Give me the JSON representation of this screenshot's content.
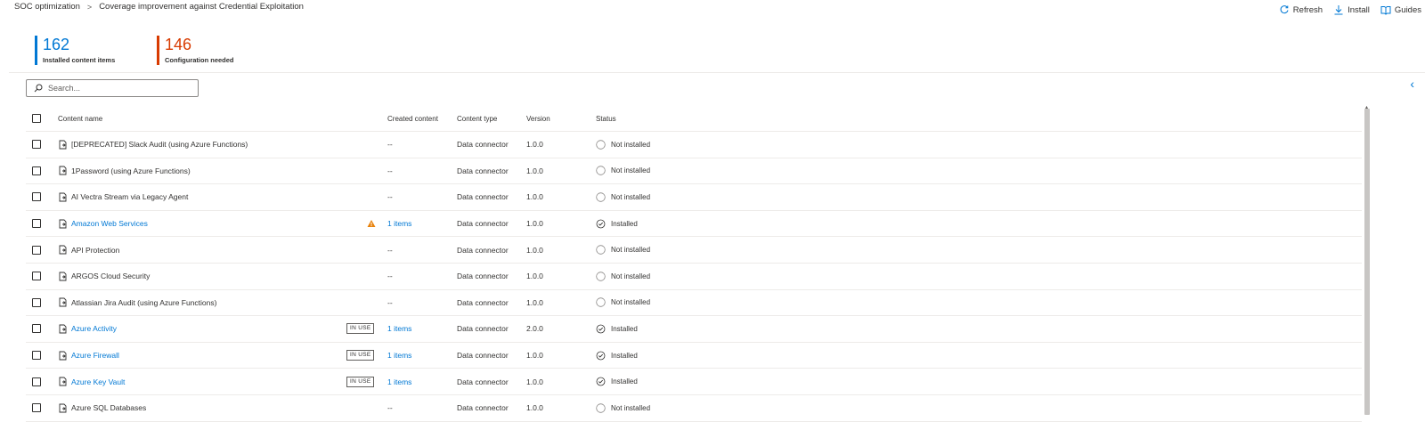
{
  "breadcrumb": {
    "root": "SOC optimization",
    "separator": ">",
    "current": "Coverage improvement against Credential Exploitation"
  },
  "toolbar": {
    "refresh": "Refresh",
    "install": "Install",
    "guides": "Guides"
  },
  "stats": [
    {
      "value": "162",
      "label": "Installed content items",
      "color": "#0078d4"
    },
    {
      "value": "146",
      "label": "Configuration needed",
      "color": "#d83b01"
    }
  ],
  "search": {
    "placeholder": "Search..."
  },
  "table": {
    "headers": {
      "name": "Content name",
      "created": "Created content",
      "type": "Content type",
      "version": "Version",
      "status": "Status"
    },
    "rows": [
      {
        "name": "[DEPRECATED] Slack Audit (using Azure Functions)",
        "link": false,
        "badge": "",
        "warn": false,
        "created": "--",
        "type": "Data connector",
        "version": "1.0.0",
        "status": "Not installed"
      },
      {
        "name": "1Password (using Azure Functions)",
        "link": false,
        "badge": "",
        "warn": false,
        "created": "--",
        "type": "Data connector",
        "version": "1.0.0",
        "status": "Not installed"
      },
      {
        "name": "AI Vectra Stream via Legacy Agent",
        "link": false,
        "badge": "",
        "warn": false,
        "created": "--",
        "type": "Data connector",
        "version": "1.0.0",
        "status": "Not installed"
      },
      {
        "name": "Amazon Web Services",
        "link": true,
        "badge": "",
        "warn": true,
        "created": "1 items",
        "type": "Data connector",
        "version": "1.0.0",
        "status": "Installed"
      },
      {
        "name": "API Protection",
        "link": false,
        "badge": "",
        "warn": false,
        "created": "--",
        "type": "Data connector",
        "version": "1.0.0",
        "status": "Not installed"
      },
      {
        "name": "ARGOS Cloud Security",
        "link": false,
        "badge": "",
        "warn": false,
        "created": "--",
        "type": "Data connector",
        "version": "1.0.0",
        "status": "Not installed"
      },
      {
        "name": "Atlassian Jira Audit (using Azure Functions)",
        "link": false,
        "badge": "",
        "warn": false,
        "created": "--",
        "type": "Data connector",
        "version": "1.0.0",
        "status": "Not installed"
      },
      {
        "name": "Azure Activity",
        "link": true,
        "badge": "IN USE",
        "warn": false,
        "created": "1 items",
        "type": "Data connector",
        "version": "2.0.0",
        "status": "Installed"
      },
      {
        "name": "Azure Firewall",
        "link": true,
        "badge": "IN USE",
        "warn": false,
        "created": "1 items",
        "type": "Data connector",
        "version": "1.0.0",
        "status": "Installed"
      },
      {
        "name": "Azure Key Vault",
        "link": true,
        "badge": "IN USE",
        "warn": false,
        "created": "1 items",
        "type": "Data connector",
        "version": "1.0.0",
        "status": "Installed"
      },
      {
        "name": "Azure SQL Databases",
        "link": false,
        "badge": "",
        "warn": false,
        "created": "--",
        "type": "Data connector",
        "version": "1.0.0",
        "status": "Not installed"
      }
    ]
  },
  "colors": {
    "accent": "#0078d4",
    "warning": "#d83b01",
    "warn_icon": "#e8820c"
  }
}
